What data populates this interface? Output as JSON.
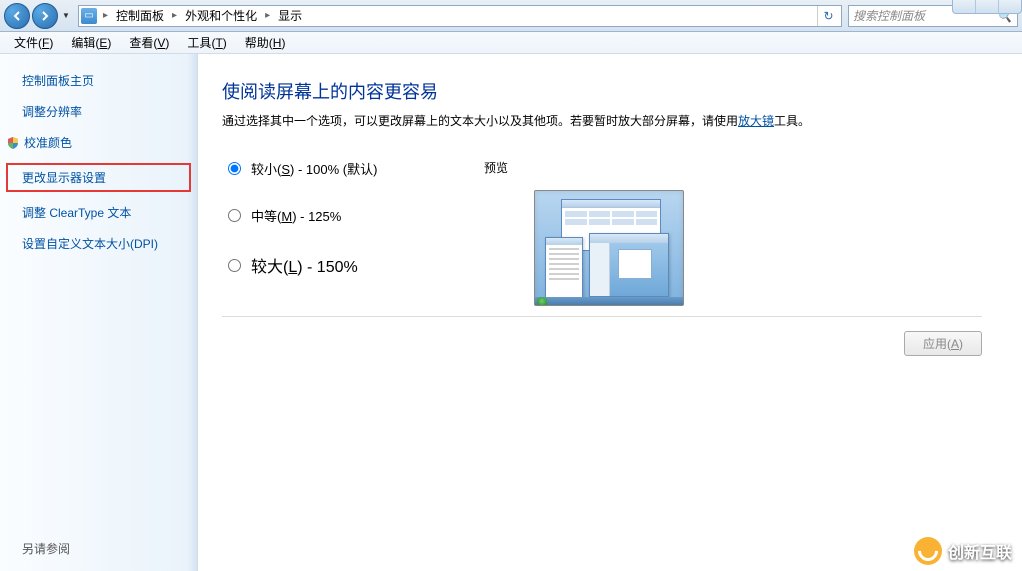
{
  "nav": {
    "breadcrumb": [
      "控制面板",
      "外观和个性化",
      "显示"
    ],
    "search_placeholder": "搜索控制面板"
  },
  "menu": {
    "items": [
      {
        "label": "文件",
        "key": "F"
      },
      {
        "label": "编辑",
        "key": "E"
      },
      {
        "label": "查看",
        "key": "V"
      },
      {
        "label": "工具",
        "key": "T"
      },
      {
        "label": "帮助",
        "key": "H"
      }
    ]
  },
  "sidebar": {
    "items": [
      {
        "label": "控制面板主页",
        "highlighted": false
      },
      {
        "label": "调整分辨率",
        "highlighted": false
      },
      {
        "label": "校准颜色",
        "highlighted": false,
        "shield": true
      },
      {
        "label": "更改显示器设置",
        "highlighted": true
      },
      {
        "label": "调整 ClearType 文本",
        "highlighted": false
      },
      {
        "label": "设置自定义文本大小(DPI)",
        "highlighted": false
      }
    ],
    "footer": "另请参阅"
  },
  "content": {
    "title": "使阅读屏幕上的内容更容易",
    "desc_pre": "通过选择其中一个选项，可以更改屏幕上的文本大小以及其他项。若要暂时放大部分屏幕，请使用",
    "desc_link": "放大镜",
    "desc_post": "工具。",
    "options": [
      {
        "label_pre": "较小(",
        "key": "S",
        "label_post": ") - 100% (默认)",
        "checked": true,
        "size": "normal"
      },
      {
        "label_pre": "中等(",
        "key": "M",
        "label_post": ") - 125%",
        "checked": false,
        "size": "normal"
      },
      {
        "label_pre": "较大(",
        "key": "L",
        "label_post": ") - 150%",
        "checked": false,
        "size": "large"
      }
    ],
    "preview_label": "预览",
    "apply_label_pre": "应用(",
    "apply_key": "A",
    "apply_label_post": ")"
  },
  "watermark": "创新互联"
}
